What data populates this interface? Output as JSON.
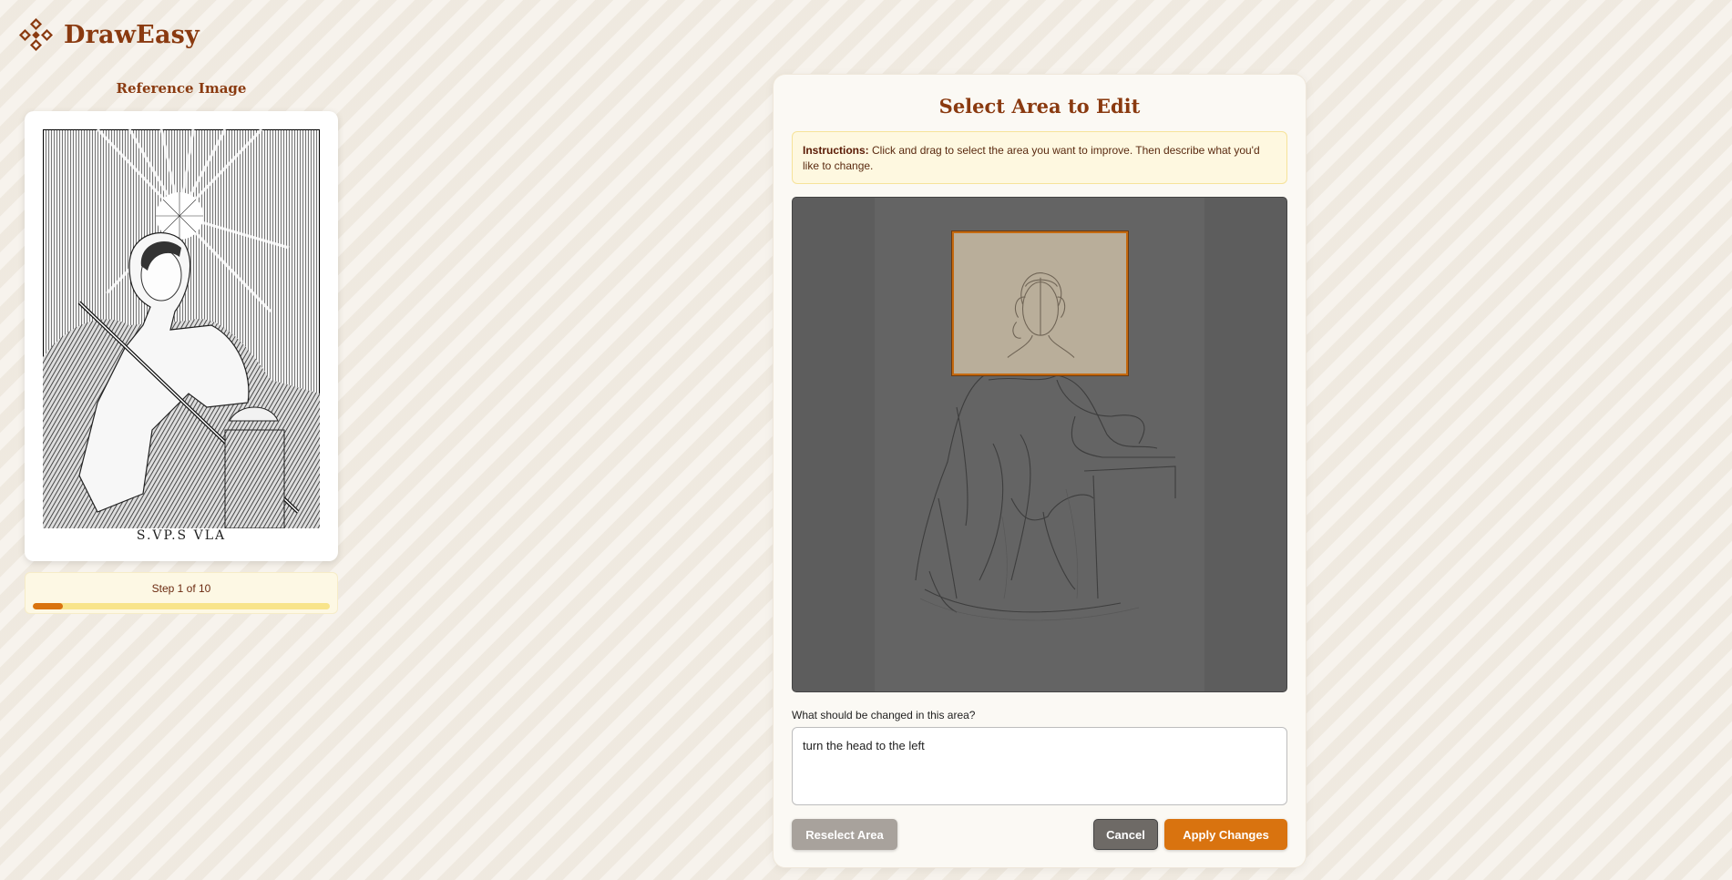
{
  "app": {
    "name": "DrawEasy",
    "logo_icon": "diamond-pattern-icon",
    "brand_color": "#8a3a10",
    "accent_color": "#d9730f"
  },
  "reference": {
    "title": "Reference Image",
    "caption": "S.VP.S VLA",
    "progress": {
      "label": "Step 1 of 10",
      "current": 1,
      "total": 10
    }
  },
  "editor": {
    "title": "Select Area to Edit",
    "instructions": {
      "bold": "Instructions:",
      "text": " Click and drag to select the area you want to improve. Then describe what you'd like to change."
    },
    "change_label": "What should be changed in this area?",
    "change_value": "turn the head to the left",
    "buttons": {
      "reselect": "Reselect Area",
      "cancel": "Cancel",
      "apply": "Apply Changes"
    }
  }
}
